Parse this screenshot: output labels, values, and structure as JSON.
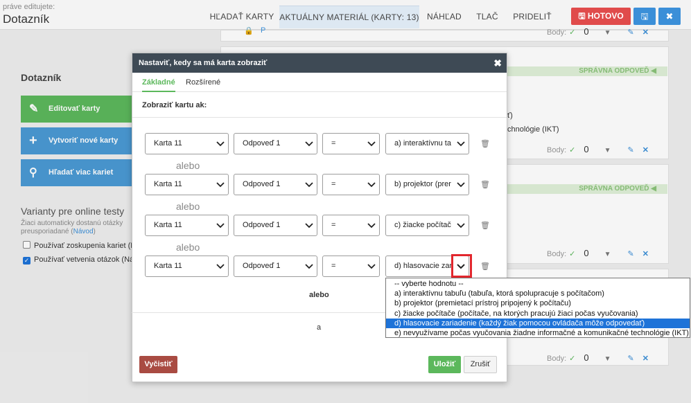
{
  "header": {
    "editing_label": "práve editujete:",
    "doc_title": "Dotazník",
    "tabs": [
      {
        "label": "HĽADAŤ KARTY"
      },
      {
        "label": "AKTUÁLNY MATERIÁL (KARTY: 13)"
      },
      {
        "label": "NÁHĽAD"
      },
      {
        "label": "TLAČ"
      },
      {
        "label": "PRIDELIŤ"
      }
    ],
    "done_label": "HOTOVO",
    "accent_red": "#e04b4b",
    "accent_blue": "#3b8fd8"
  },
  "sidebar": {
    "title": "Dotazník",
    "buttons": [
      {
        "label": "Editovať karty",
        "icon": "pencil-icon"
      },
      {
        "label": "Vytvoriť nové karty",
        "icon": "plus-icon"
      },
      {
        "label": "Hľadať viac kariet",
        "icon": "search-icon"
      }
    ],
    "variants_title": "Varianty pre online testy",
    "variants_desc_1": "Žiaci automaticky dostanú otázky",
    "variants_desc_2": "preusporiadané (",
    "variants_link": "Návod",
    "variants_desc_3": ")",
    "checkbox_1": "Používať zoskupenia kariet (N",
    "checkbox_2": "Používať vetvenia otázok (Ná"
  },
  "background": {
    "correct_answer_label": "SPRÁVNA ODPOVEĎ",
    "body_label": "Body:",
    "points_value": "0",
    "fragment_1": "ť)",
    "fragment_2": "chnológie (IKT)",
    "fragment_3": "P"
  },
  "modal": {
    "title": "Nastaviť, kedy sa má karta zobraziť",
    "tabs": [
      {
        "label": "Základné"
      },
      {
        "label": "Rozšírené"
      }
    ],
    "subheading": "Zobraziť kartu ak:",
    "conditions": [
      {
        "card": "Karta 11",
        "answer": "Odpoveď 1",
        "op": "=",
        "value": "a) interaktívnu ta"
      },
      {
        "card": "Karta 11",
        "answer": "Odpoveď 1",
        "op": "=",
        "value": "b) projektor (prer"
      },
      {
        "card": "Karta 11",
        "answer": "Odpoveď 1",
        "op": "=",
        "value": "c) žiacke počítač"
      },
      {
        "card": "Karta 11",
        "answer": "Odpoveď 1",
        "op": "=",
        "value": "d) hlasovacie zar"
      }
    ],
    "or_label": "alebo",
    "or_group_label": "alebo",
    "and_label": "a",
    "clear_label": "Vyčistiť",
    "save_label": "Uložiť",
    "cancel_label": "Zrušiť"
  },
  "dropdown": {
    "options": [
      {
        "label": "-- vyberte hodnotu --"
      },
      {
        "label": "a) interaktívnu tabuľu (tabuľa, ktorá spolupracuje s počítačom)"
      },
      {
        "label": "b) projektor (premietací prístroj pripojený k počítaču)"
      },
      {
        "label": "c) žiacke počítače (počítače, na ktorých pracujú žiaci počas vyučovania)"
      },
      {
        "label": "d) hlasovacie zariadenie (každý žiak pomocou ovládača môže odpovedať)"
      },
      {
        "label": "e) nevyužívame počas vyučovania žiadne informačné a komunikačné technológie (IKT)"
      }
    ],
    "selected_index": 4
  }
}
